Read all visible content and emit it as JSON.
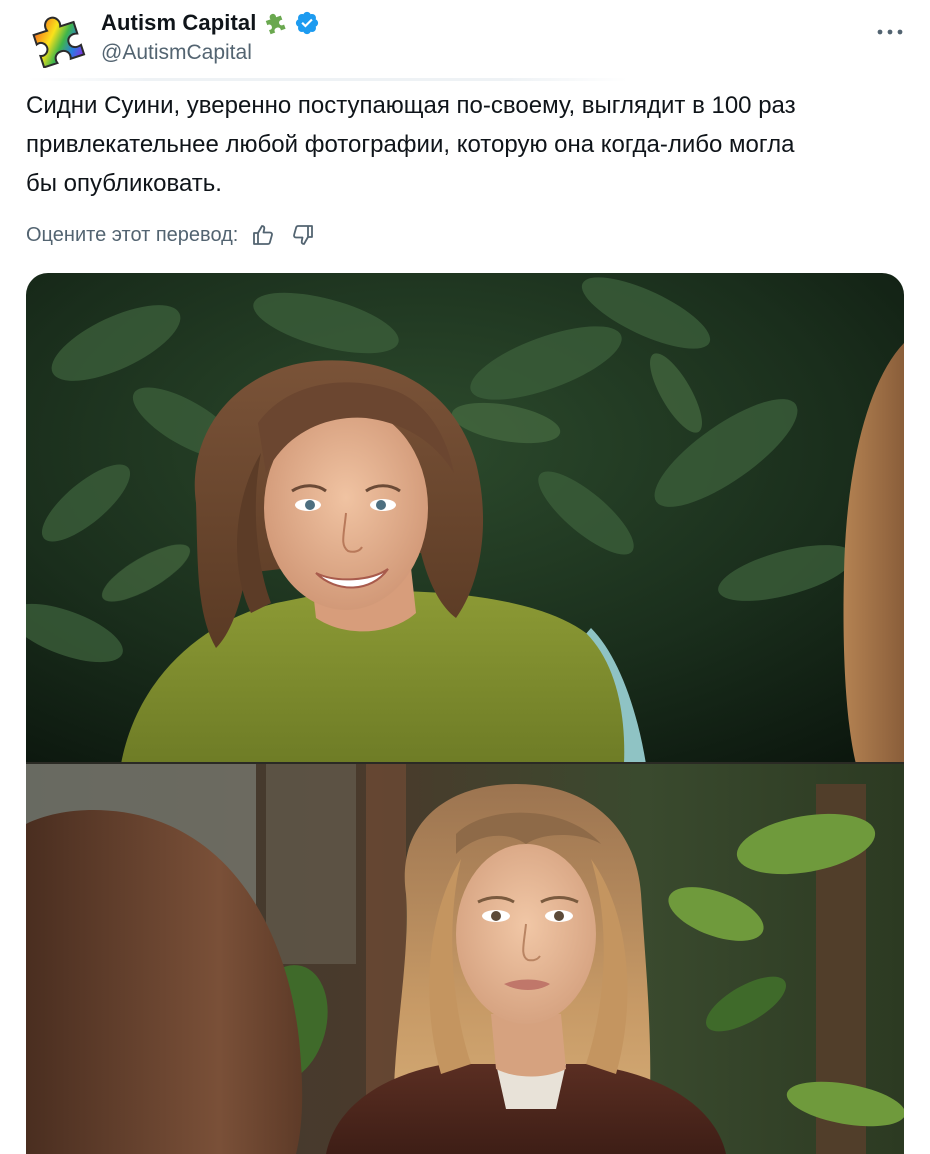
{
  "post": {
    "author": {
      "display_name": "Autism Capital",
      "handle": "@AutismCapital",
      "avatar_icon": "rainbow-puzzle-piece-icon",
      "badge_icon": "green-puzzle-piece-icon",
      "verified_icon": "verified-badge-icon"
    },
    "more_icon": "more-horizontal-icon",
    "text": "Сидни Суини, уверенно поступающая по-своему, выглядит в 100 раз\nпривлекательнее любой фотографии, которую она когда-либо могла\nбы опубликовать.",
    "translation": {
      "rate_label": "Оцените этот перевод:",
      "like_icon": "thumbs-up-icon",
      "dislike_icon": "thumbs-down-icon"
    },
    "media": {
      "photos": [
        {
          "name": "top-photo"
        },
        {
          "name": "bottom-photo"
        }
      ]
    }
  },
  "colors": {
    "text_primary": "#0f1419",
    "text_secondary": "#536471",
    "verified_blue": "#1d9bf0",
    "puzzle_green": "#6aa84f"
  }
}
